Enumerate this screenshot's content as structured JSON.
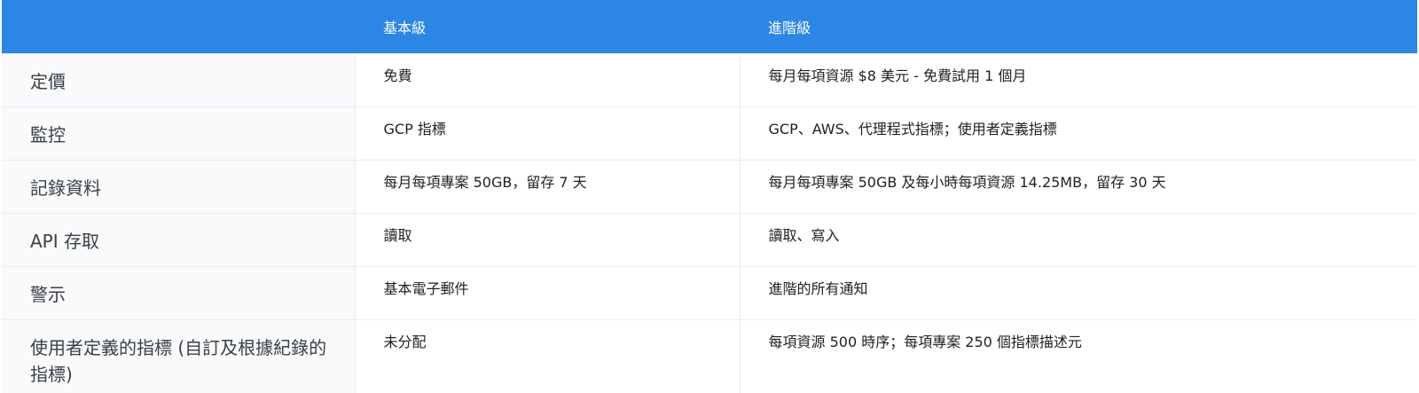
{
  "table": {
    "headers": [
      "",
      "基本級",
      "進階級"
    ],
    "rows": [
      {
        "feature": "定價",
        "basic": "免費",
        "premium": "每月每項資源 $8 美元 - 免費試用 1 個月"
      },
      {
        "feature": "監控",
        "basic": "GCP 指標",
        "premium": "GCP、AWS、代理程式指標；使用者定義指標"
      },
      {
        "feature": "記錄資料",
        "basic": "每月每項專案 50GB，留存 7 天",
        "premium": "每月每項專案 50GB 及每小時每項資源 14.25MB，留存 30 天"
      },
      {
        "feature": "API 存取",
        "basic": "讀取",
        "premium": "讀取、寫入"
      },
      {
        "feature": "警示",
        "basic": "基本電子郵件",
        "premium": "進階的所有通知"
      },
      {
        "feature": "使用者定義的指標 (自訂及根據紀錄的指標)",
        "basic": "未分配",
        "premium": "每項資源 500 時序；每項專案 250 個指標描述元"
      }
    ]
  },
  "colors": {
    "header_bg": "#2b86e6",
    "header_text": "#ffffff",
    "feature_bg": "#f8fafc"
  }
}
